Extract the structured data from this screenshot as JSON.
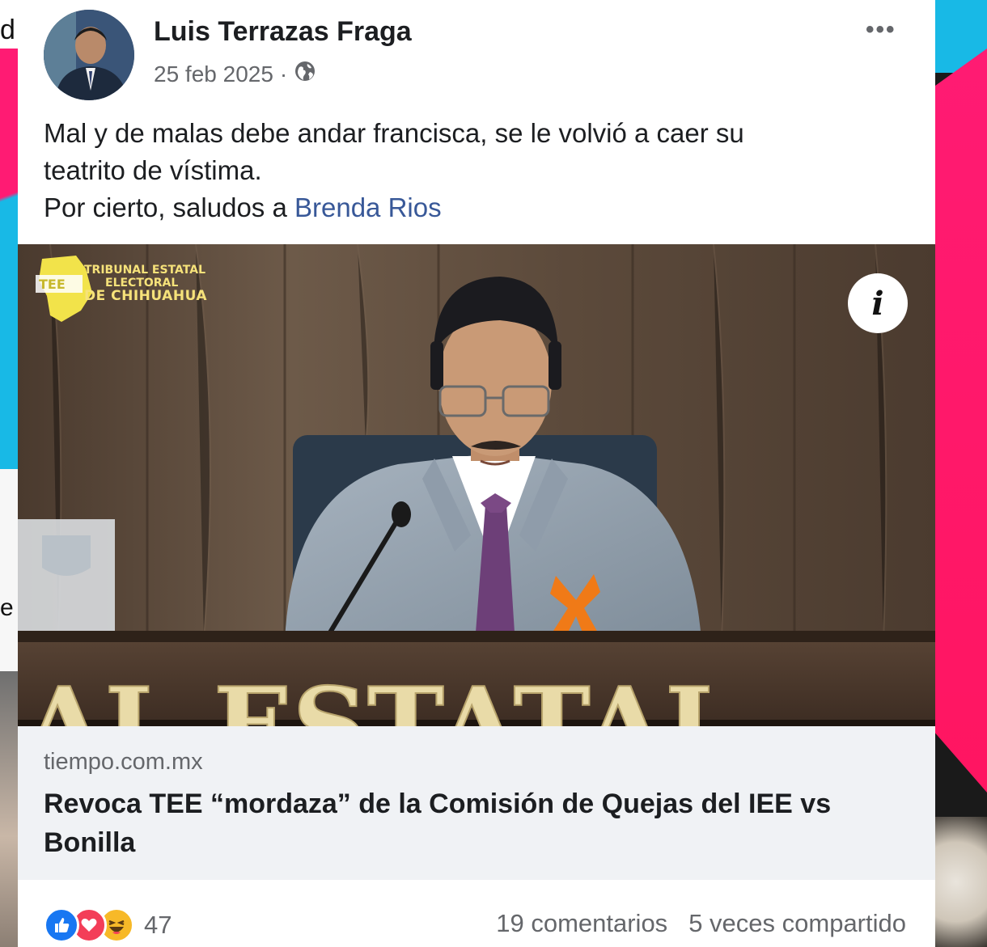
{
  "post": {
    "author": "Luis Terrazas Fraga",
    "date": "25 feb 2025",
    "separator": "·",
    "audience_icon": "globe-icon",
    "more_icon": "more-options-icon",
    "text_line1": "Mal y de malas debe andar francisca, se le volvió a caer su",
    "text_line2": "teatrito de vístima.",
    "text_line3_prefix": "Por cierto, saludos a ",
    "mention": "Brenda Rios"
  },
  "link": {
    "image_logo_line1": "TRIBUNAL ESTATAL",
    "image_logo_line2": "ELECTORAL",
    "image_logo_line3": "DE CHIHUAHUA",
    "image_sign_text": "AL ESTATAL",
    "info_icon": "i",
    "domain": "tiempo.com.mx",
    "headline": "Revoca TEE “mordaza” de la Comisión de Quejas del IEE vs Bonilla"
  },
  "footer": {
    "reaction_icons": [
      "like-icon",
      "love-icon",
      "haha-icon"
    ],
    "reaction_count": "47",
    "comments": "19 comentarios",
    "shares": "5 veces compartido"
  },
  "colors": {
    "mention": "#385898",
    "like": "#1877f2",
    "love": "#f33e58",
    "haha": "#f7b928",
    "background_pink": "#ff1b73",
    "background_cyan": "#18b9e6"
  }
}
